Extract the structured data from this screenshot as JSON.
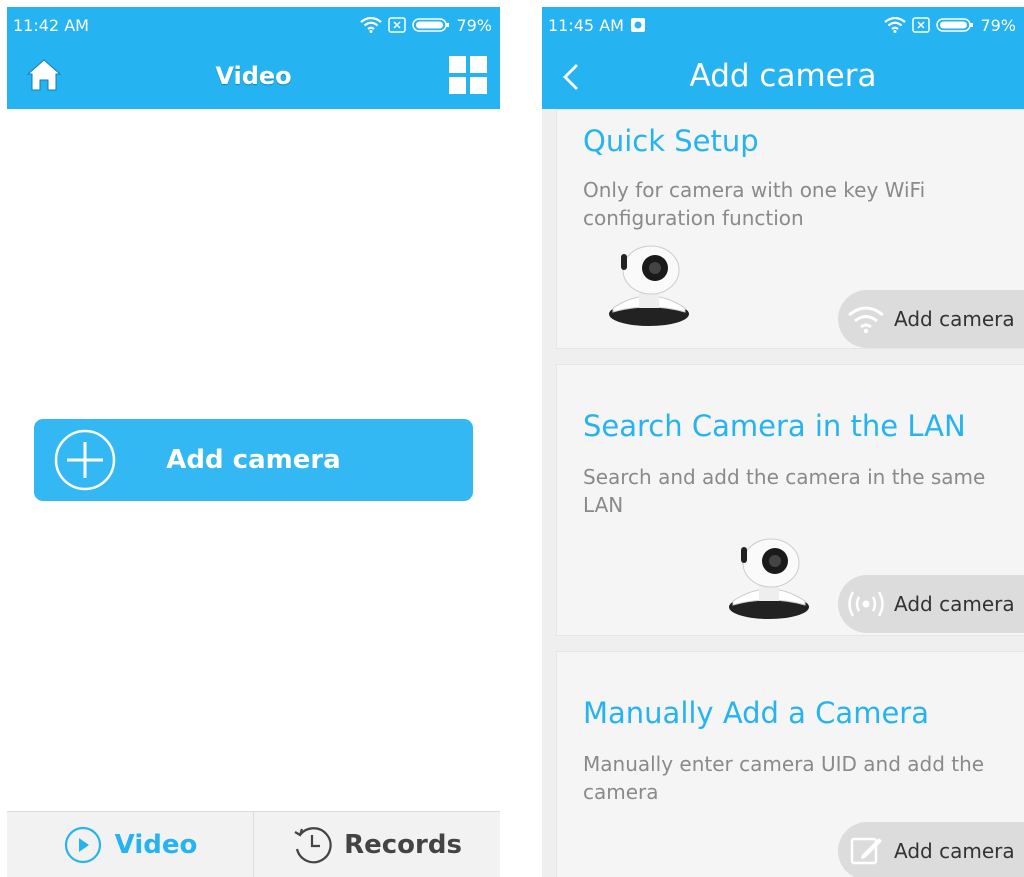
{
  "left_screen": {
    "status": {
      "time": "11:42 AM",
      "battery": "79%"
    },
    "header": {
      "title": "Video"
    },
    "add_camera_label": "Add camera",
    "tabs": [
      {
        "label": "Video",
        "icon": "play-circle-icon",
        "active": true
      },
      {
        "label": "Records",
        "icon": "history-clock-icon",
        "active": false
      }
    ]
  },
  "right_screen": {
    "status": {
      "time": "11:45 AM",
      "battery": "79%"
    },
    "header": {
      "title": "Add camera"
    },
    "cards": [
      {
        "title": "Quick Setup",
        "description": "Only for camera with one key WiFi configuration function",
        "button_label": "Add camera",
        "button_icon": "wifi-icon"
      },
      {
        "title": "Search Camera in the LAN",
        "description": "Search and add the camera in the same LAN",
        "button_label": "Add camera",
        "button_icon": "broadcast-icon"
      },
      {
        "title": "Manually Add a Camera",
        "description": "Manually enter camera UID and add the camera",
        "button_label": "Add camera",
        "button_icon": "edit-icon"
      }
    ]
  },
  "colors": {
    "accent": "#26b3f1",
    "button": "#33b8f3",
    "pill": "#dcdcdc",
    "card_bg": "#f5f5f5",
    "muted_text": "#8a8a8a"
  }
}
